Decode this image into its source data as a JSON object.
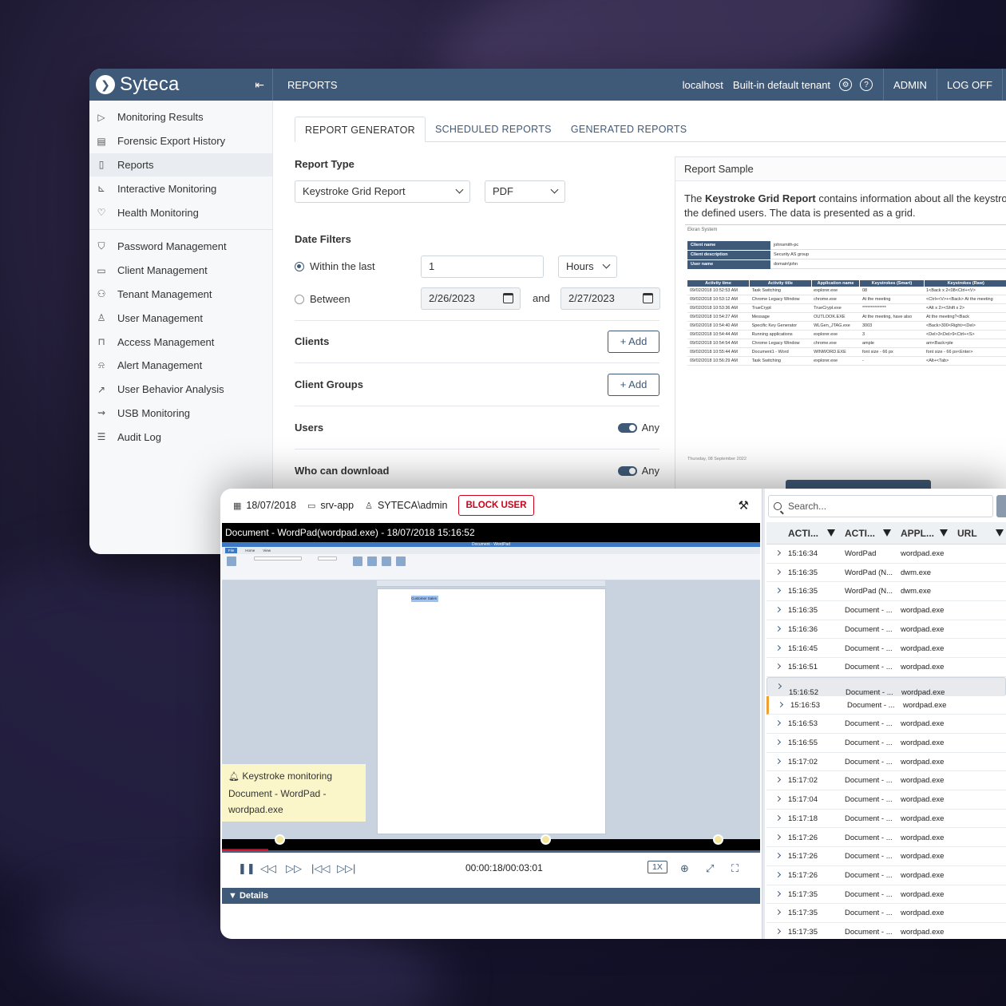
{
  "app": {
    "brand": "Syteca",
    "section_title": "REPORTS",
    "server": "localhost",
    "tenant": "Built-in default tenant",
    "admin_label": "ADMIN",
    "logoff_label": "LOG OFF",
    "accent_color": "#3f5a78"
  },
  "sidebar": {
    "items": [
      {
        "label": "Monitoring Results",
        "icon": "play-icon"
      },
      {
        "label": "Forensic Export History",
        "icon": "film-icon"
      },
      {
        "label": "Reports",
        "icon": "document-icon",
        "active": true
      },
      {
        "label": "Interactive Monitoring",
        "icon": "chart-icon"
      },
      {
        "label": "Health Monitoring",
        "icon": "heart-icon"
      }
    ],
    "admin_items": [
      {
        "label": "Password Management",
        "icon": "shield-icon"
      },
      {
        "label": "Client Management",
        "icon": "monitor-icon"
      },
      {
        "label": "Tenant Management",
        "icon": "hierarchy-icon"
      },
      {
        "label": "User Management",
        "icon": "user-icon"
      },
      {
        "label": "Access Management",
        "icon": "lock-icon"
      },
      {
        "label": "Alert Management",
        "icon": "bell-icon"
      },
      {
        "label": "User Behavior Analysis",
        "icon": "trend-icon"
      },
      {
        "label": "USB Monitoring",
        "icon": "usb-icon"
      },
      {
        "label": "Audit Log",
        "icon": "list-icon"
      }
    ]
  },
  "tabs": [
    "REPORT GENERATOR",
    "SCHEDULED REPORTS",
    "GENERATED REPORTS"
  ],
  "form": {
    "report_type_label": "Report Type",
    "report_type_value": "Keystroke Grid Report",
    "format_value": "PDF",
    "date_filters_label": "Date Filters",
    "within_label": "Within the last",
    "within_value": "1",
    "unit_value": "Hours",
    "between_label": "Between",
    "date_from": "2/26/2023",
    "and_label": "and",
    "date_to": "2/27/2023",
    "clients_label": "Clients",
    "client_groups_label": "Client Groups",
    "add_label": "+ Add",
    "users_label": "Users",
    "who_download_label": "Who can download",
    "any_label": "Any"
  },
  "sample": {
    "title": "Report Sample",
    "desc_pre": "The ",
    "desc_bold": "Keystroke Grid Report",
    "desc_post": " contains information about all the keystrokes",
    "desc_line2": "the defined users. The data is presented as a grid.",
    "mini_title": "Ekran System",
    "mini_kv": [
      {
        "k": "Client name",
        "v": "johnsmith-pc"
      },
      {
        "k": "Client description",
        "v": "Security AS group"
      },
      {
        "k": "User name",
        "v": "domain\\john"
      }
    ],
    "mini_headers": [
      "Activity time",
      "Activity title",
      "Application name",
      "Keystrokes (Smart)",
      "Keystrokes (Raw)"
    ],
    "mini_rows": [
      [
        "09/02/2018 10:52:53 AM",
        "Task Switching",
        "explorer.exe",
        "08",
        "1<Back x 2<08<Ctrl+<V>"
      ],
      [
        "09/02/2018 10:53:12 AM",
        "Chrome Legacy Window",
        "chrome.exe",
        "At the meeting",
        "<Ctrl+<V>+<Back> At the meeting"
      ],
      [
        "09/02/2018 10:53:36 AM",
        "TrueCrypt",
        "TrueCrypt.exe",
        "**************",
        "<Alt x 2><Shift x 2>"
      ],
      [
        "09/02/2018 10:54:27 AM",
        "Message",
        "OUTLOOK.EXE",
        "At the meeting, have also",
        "At the meeting?<Back"
      ],
      [
        "09/02/2018 10:54:40 AM",
        "Specific Key Generator",
        "WLGen_JTAG.exe",
        "3003",
        "<Back>300<Right><Del>"
      ],
      [
        "09/02/2018 10:54:44 AM",
        "Running applications",
        "explorer.exe",
        "3",
        "<Del>3<Del>9<Ctrl+<S>"
      ],
      [
        "09/02/2018 10:54:54 AM",
        "Chrome Legacy Window",
        "chrome.exe",
        "ample",
        "am<Back>ple"
      ],
      [
        "09/02/2018 10:55:44 AM",
        "Document1 - Word",
        "WINWORD.EXE",
        "font size - 66 px",
        "font size - 66 px<Enter>"
      ],
      [
        "09/02/2018 10:56:29 AM",
        "Task Switching",
        "explorer.exe",
        "-",
        "<Alt+<Tab>"
      ]
    ],
    "mini_footer": "Thursday, 08 September 2022"
  },
  "player": {
    "date": "18/07/2018",
    "host": "srv-app",
    "user": "SYTECA\\admin",
    "block_label": "BLOCK USER",
    "video_title": "Document - WordPad(wordpad.exe) - 18/07/2018 15:16:52",
    "wordpad_title": "Document - WordPad",
    "wordpad_tabs": [
      "File",
      "Home",
      "View"
    ],
    "wordpad_text": "Customer Sales",
    "notification_title": "Keystroke monitoring",
    "notification_line2": "Document - WordPad -",
    "notification_line3": "wordpad.exe",
    "timecode": "00:00:18/00:03:01",
    "speed": "1X",
    "progress": 0.086,
    "details_label": "▼ Details"
  },
  "grid": {
    "search_placeholder": "Search...",
    "headers": [
      "ACTI...",
      "ACTI...",
      "APPL...",
      "URL"
    ],
    "rows": [
      [
        "15:16:34",
        "WordPad",
        "wordpad.exe"
      ],
      [
        "15:16:35",
        "WordPad (N...",
        "dwm.exe"
      ],
      [
        "15:16:35",
        "WordPad (N...",
        "dwm.exe"
      ],
      [
        "15:16:35",
        "Document - ...",
        "wordpad.exe"
      ],
      [
        "15:16:36",
        "Document - ...",
        "wordpad.exe"
      ],
      [
        "15:16:45",
        "Document - ...",
        "wordpad.exe"
      ],
      [
        "15:16:51",
        "Document - ...",
        "wordpad.exe"
      ],
      [
        "15:16:52",
        "Document - ...",
        "wordpad.exe"
      ],
      [
        "15:16:53",
        "Document - ...",
        "wordpad.exe"
      ],
      [
        "15:16:53",
        "Document - ...",
        "wordpad.exe"
      ],
      [
        "15:16:55",
        "Document - ...",
        "wordpad.exe"
      ],
      [
        "15:17:02",
        "Document - ...",
        "wordpad.exe"
      ],
      [
        "15:17:02",
        "Document - ...",
        "wordpad.exe"
      ],
      [
        "15:17:04",
        "Document - ...",
        "wordpad.exe"
      ],
      [
        "15:17:18",
        "Document - ...",
        "wordpad.exe"
      ],
      [
        "15:17:26",
        "Document - ...",
        "wordpad.exe"
      ],
      [
        "15:17:26",
        "Document - ...",
        "wordpad.exe"
      ],
      [
        "15:17:26",
        "Document - ...",
        "wordpad.exe"
      ],
      [
        "15:17:35",
        "Document - ...",
        "wordpad.exe"
      ],
      [
        "15:17:35",
        "Document - ...",
        "wordpad.exe"
      ],
      [
        "15:17:35",
        "Document - ...",
        "wordpad.exe"
      ]
    ],
    "selected_index": 7,
    "marked_index": 8
  }
}
